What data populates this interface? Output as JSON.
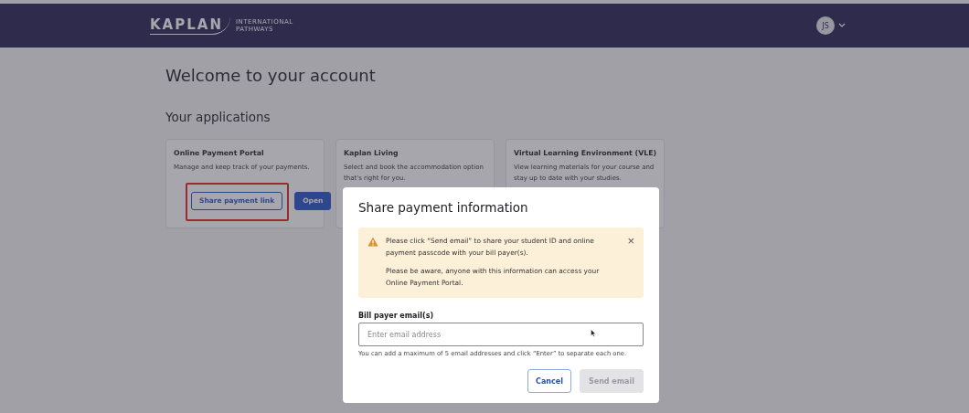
{
  "header": {
    "logo": "KAPLAN",
    "logo_subtitle": [
      "INTERNATIONAL",
      "PATHWAYS"
    ],
    "avatar": "JS"
  },
  "page": {
    "title": "Welcome to your account",
    "section": "Your applications"
  },
  "cards": [
    {
      "title": "Online Payment Portal",
      "text": "Manage and keep track of your payments.",
      "buttons": [
        {
          "label": "Share payment link",
          "kind": "secondary",
          "highlighted": true
        },
        {
          "label": "Open",
          "kind": "primary",
          "highlighted": false
        }
      ]
    },
    {
      "title": "Kaplan Living",
      "text": "Select and book the accommodation option that's right for you."
    },
    {
      "title": "Virtual Learning Environment (VLE)",
      "text": "View learning materials for your course and stay up to date with your studies."
    }
  ],
  "dialog": {
    "title": "Share payment information",
    "alert": {
      "paragraphs": [
        "Please click “Send email” to share your student ID and online payment passcode with your bill payer(s).",
        "Please be aware, anyone with this information can access your Online Payment Portal."
      ],
      "close": "×"
    },
    "field": {
      "label": "Bill payer email(s)",
      "placeholder": "Enter email address",
      "hint": "You can add a maximum of 5 email addresses and click “Enter” to separate each one."
    },
    "buttons": [
      {
        "label": "Cancel",
        "kind": "secondary",
        "disabled": false
      },
      {
        "label": "Send email",
        "kind": "primary",
        "disabled": true
      }
    ]
  }
}
